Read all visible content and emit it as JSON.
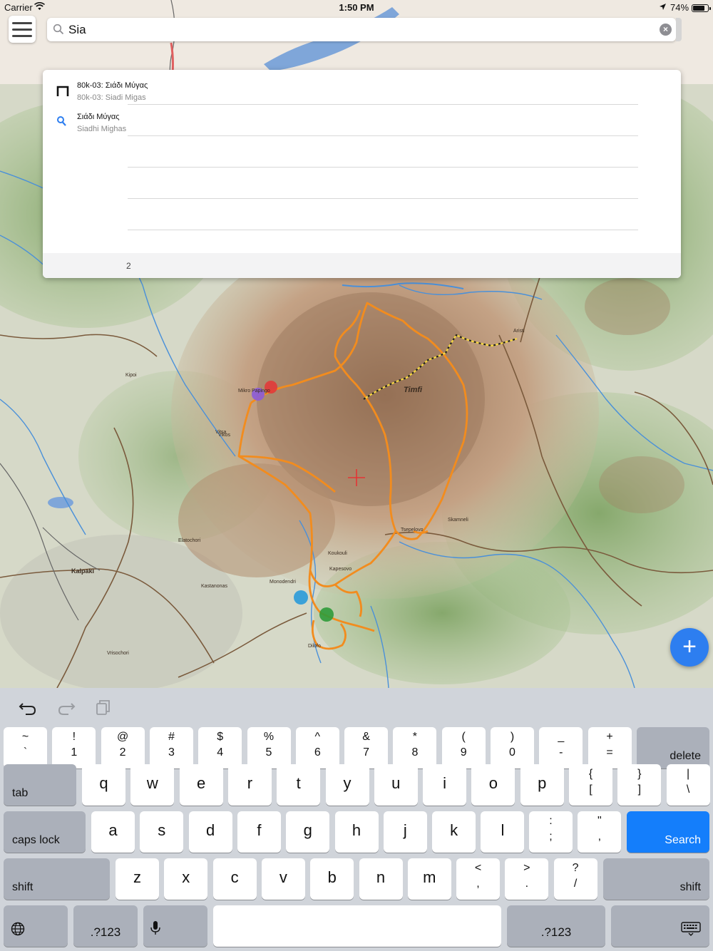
{
  "status_bar": {
    "carrier": "Carrier",
    "time": "1:50 PM",
    "battery": "74%"
  },
  "search": {
    "value": "Sia",
    "placeholder": ""
  },
  "results": [
    {
      "title": "80k-03: Σιάδι Μύγας",
      "subtitle": "80k-03: Siadi Migas",
      "icon": "trail-marker-icon"
    },
    {
      "title": "Σιάδι Μύγας",
      "subtitle": "Siadhi Mighas",
      "icon": "location-pin-icon"
    }
  ],
  "results_count": "2",
  "map": {
    "labels": [
      "Timfi",
      "Kalpaki",
      "Skamneli",
      "Tsepelovo",
      "Kapesovo",
      "Vitsa",
      "Monodendri",
      "Koukouli",
      "Dilofo",
      "Elatochori",
      "Kipoi",
      "Aristi",
      "Mikro Papingo",
      "Vikos",
      "Vrisochori",
      "Kastanonas"
    ],
    "colors": {
      "route": "#f28c1e",
      "river": "#4a90d9",
      "relief": "#b08a6a",
      "forest": "#9dbb83",
      "road": "#7a5a3c",
      "lake": "#7fa6d9"
    }
  },
  "fab": {
    "label": "+"
  },
  "keyboard": {
    "row1": [
      {
        "top": "~",
        "bot": "`"
      },
      {
        "top": "!",
        "bot": "1"
      },
      {
        "top": "@",
        "bot": "2"
      },
      {
        "top": "#",
        "bot": "3"
      },
      {
        "top": "$",
        "bot": "4"
      },
      {
        "top": "%",
        "bot": "5"
      },
      {
        "top": "^",
        "bot": "6"
      },
      {
        "top": "&",
        "bot": "7"
      },
      {
        "top": "*",
        "bot": "8"
      },
      {
        "top": "(",
        "bot": "9"
      },
      {
        "top": ")",
        "bot": "0"
      },
      {
        "top": "_",
        "bot": "-"
      },
      {
        "top": "+",
        "bot": "="
      }
    ],
    "delete": "delete",
    "tab": "tab",
    "row2": [
      "q",
      "w",
      "e",
      "r",
      "t",
      "y",
      "u",
      "i",
      "o",
      "p"
    ],
    "row2_sym": [
      {
        "top": "{",
        "bot": "["
      },
      {
        "top": "}",
        "bot": "]"
      },
      {
        "top": "|",
        "bot": "\\"
      }
    ],
    "caps_lock": "caps lock",
    "row3": [
      "a",
      "s",
      "d",
      "f",
      "g",
      "h",
      "j",
      "k",
      "l"
    ],
    "row3_sym": [
      {
        "top": ":",
        "bot": ";"
      },
      {
        "top": "\"",
        "bot": ","
      }
    ],
    "search": "Search",
    "shift": "shift",
    "row4": [
      "z",
      "x",
      "c",
      "v",
      "b",
      "n",
      "m"
    ],
    "row4_sym": [
      {
        "top": "<",
        "bot": ","
      },
      {
        "top": ">",
        "bot": "."
      },
      {
        "top": "?",
        "bot": "/"
      }
    ],
    "numbers": ".?123"
  }
}
